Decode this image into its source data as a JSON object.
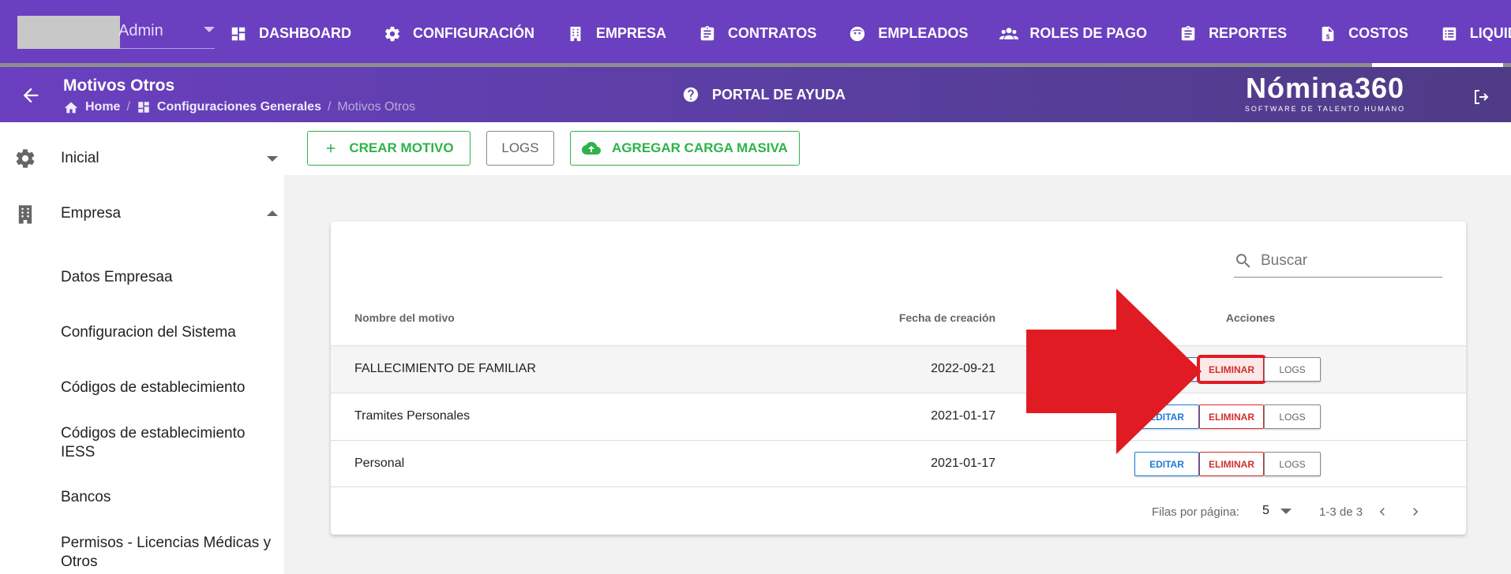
{
  "topnav": {
    "user": "Admin",
    "items": [
      {
        "label": "DASHBOARD",
        "icon": "dashboard-icon"
      },
      {
        "label": "CONFIGURACIÓN",
        "icon": "gear-icon"
      },
      {
        "label": "EMPRESA",
        "icon": "building-icon"
      },
      {
        "label": "CONTRATOS",
        "icon": "clipboard-icon"
      },
      {
        "label": "EMPLEADOS",
        "icon": "face-icon"
      },
      {
        "label": "ROLES DE PAGO",
        "icon": "group-icon"
      },
      {
        "label": "REPORTES",
        "icon": "clipboard-icon"
      },
      {
        "label": "COSTOS",
        "icon": "dollar-file-icon"
      },
      {
        "label": "LIQUIDACIONES",
        "icon": "list-icon"
      }
    ],
    "active": "LIQUIDACIONES"
  },
  "subheader": {
    "title": "Motivos Otros",
    "breadcrumb": [
      "Home",
      "Configuraciones Generales",
      "Motivos Otros"
    ],
    "help": "PORTAL DE AYUDA",
    "brand_name": "Nómina360",
    "brand_tagline": "SOFTWARE DE TALENTO HUMANO"
  },
  "sidebar": {
    "sections": [
      {
        "label": "Inicial",
        "icon": "gear-icon",
        "expanded": false
      },
      {
        "label": "Empresa",
        "icon": "building-icon",
        "expanded": true
      }
    ],
    "items": [
      "Datos Empresaa",
      "Configuracion del Sistema",
      "Códigos de establecimiento",
      "Códigos de establecimiento IESS",
      "Bancos",
      "Permisos - Licencias Médicas y Otros"
    ]
  },
  "toolbar": {
    "create": "CREAR MOTIVO",
    "logs": "LOGS",
    "bulk": "AGREGAR CARGA MASIVA"
  },
  "table": {
    "search_placeholder": "Buscar",
    "headers": {
      "name": "Nombre del motivo",
      "date": "Fecha de creación",
      "actions": "Acciones"
    },
    "rows": [
      {
        "name": "FALLECIMIENTO DE FAMILIAR",
        "date": "2022-09-21"
      },
      {
        "name": "Tramites Personales",
        "date": "2021-01-17"
      },
      {
        "name": "Personal",
        "date": "2021-01-17"
      }
    ],
    "actions": {
      "edit": "EDITAR",
      "delete": "ELIMINAR",
      "logs": "LOGS"
    },
    "footer": {
      "rows_per_page_label": "Filas por página:",
      "rows_per_page": "5",
      "range": "1-3 de 3"
    }
  },
  "colors": {
    "nav": "#6a3fc0",
    "green": "#2fb24a",
    "edit": "#1e7ad8",
    "delete": "#d32f2f",
    "annotation_arrow": "#e01b24"
  }
}
